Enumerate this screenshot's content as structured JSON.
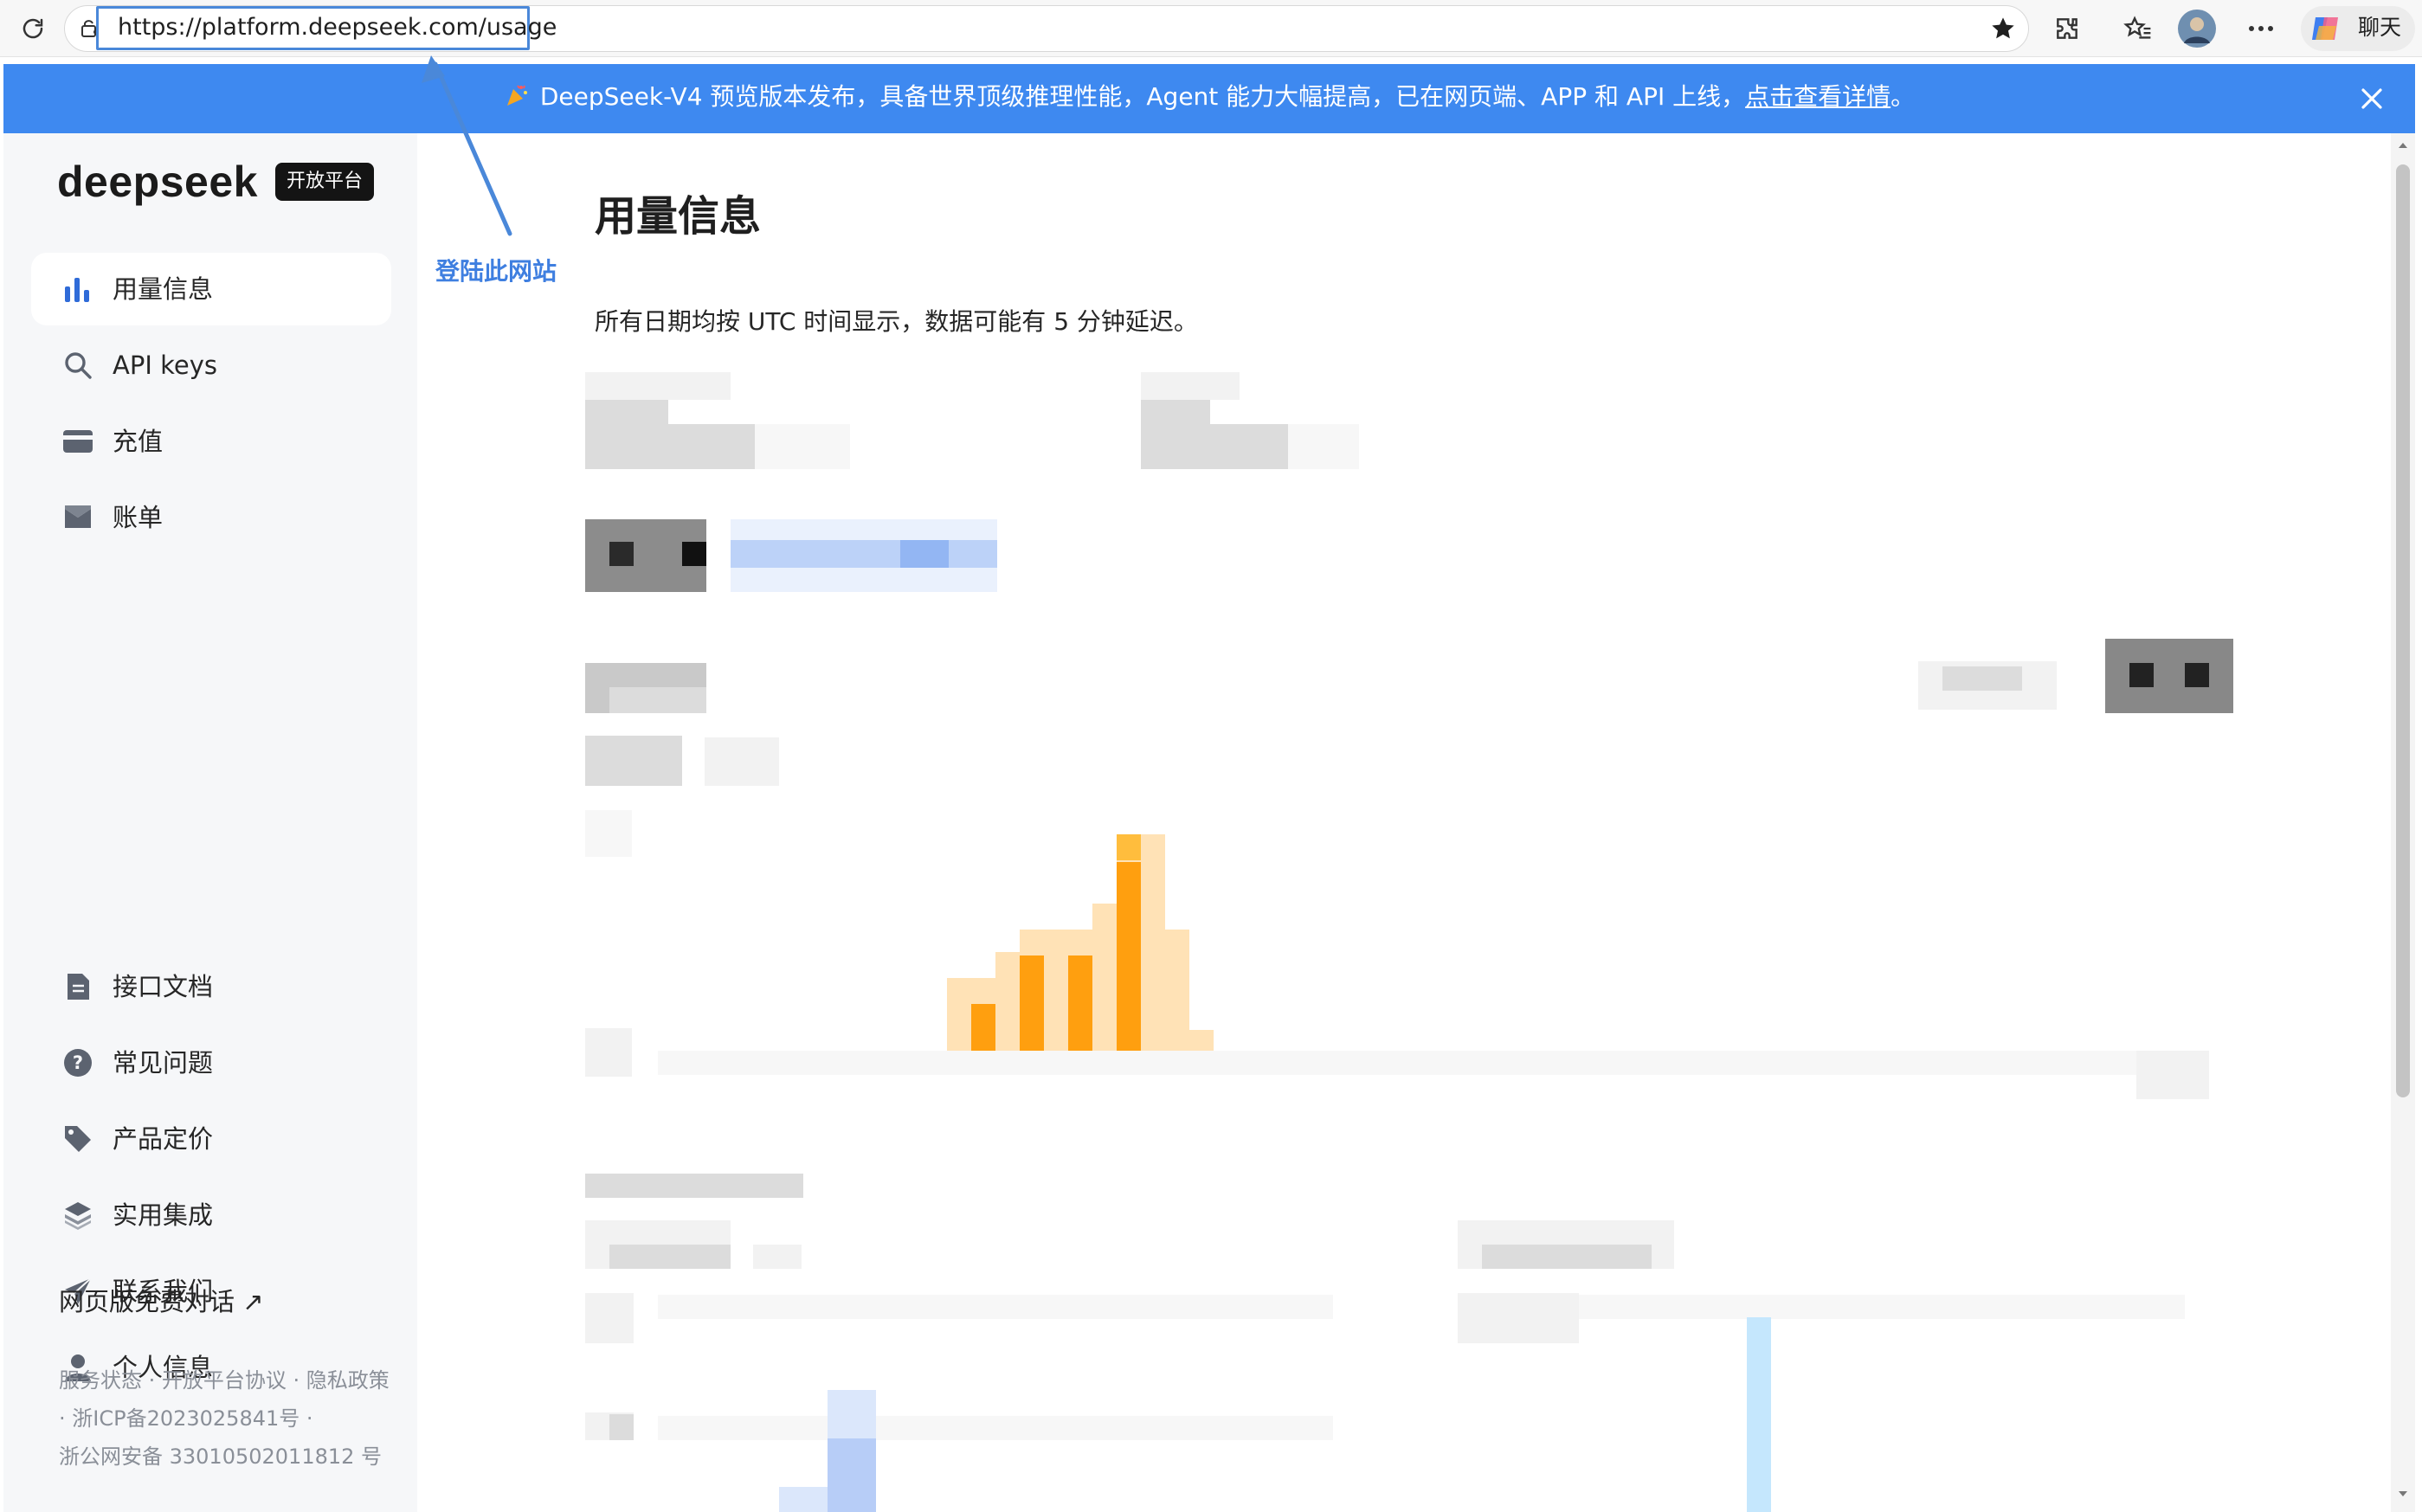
{
  "browser": {
    "url": "https://platform.deepseek.com/usage",
    "chat_label": "聊天"
  },
  "banner": {
    "text": "DeepSeek-V4 预览版本发布，具备世界顶级推理性能，Agent 能力大幅提高，已在网页端、APP 和 API 上线，",
    "link": "点击查看详情",
    "end": "。"
  },
  "brand": {
    "logo_text": "deepseek",
    "badge": "开放平台"
  },
  "sidebar": {
    "top_items": [
      {
        "label": "用量信息",
        "icon": "bar-chart-icon",
        "active": true
      },
      {
        "label": "API keys",
        "icon": "search-icon",
        "active": false
      },
      {
        "label": "充值",
        "icon": "wallet-icon",
        "active": false
      },
      {
        "label": "账单",
        "icon": "bill-icon",
        "active": false
      }
    ],
    "bottom_items": [
      {
        "label": "接口文档",
        "icon": "document-icon"
      },
      {
        "label": "常见问题",
        "icon": "help-icon"
      },
      {
        "label": "产品定价",
        "icon": "tag-icon"
      },
      {
        "label": "实用集成",
        "icon": "layers-icon"
      },
      {
        "label": "联系我们",
        "icon": "send-icon"
      },
      {
        "label": "个人信息",
        "icon": "user-icon"
      }
    ],
    "free_chat": "网页版免费对话 ↗",
    "footer": {
      "line1": "服务状态 · 开放平台协议 · 隐私政策",
      "line2": "· 浙ICP备2023025841号 ·",
      "line3": "浙公网安备 33010502011812 号"
    }
  },
  "annotation": {
    "label": "登陆此网站"
  },
  "main": {
    "title": "用量信息",
    "note": "所有日期均按 UTC 时间显示，数据可能有 5 分钟延迟。"
  },
  "colors": {
    "banner_bg": "#3e89f0",
    "accent": "#2f6bd8",
    "bar_orange": "#ff9f0f",
    "annotation_blue": "#3f7fe0"
  }
}
